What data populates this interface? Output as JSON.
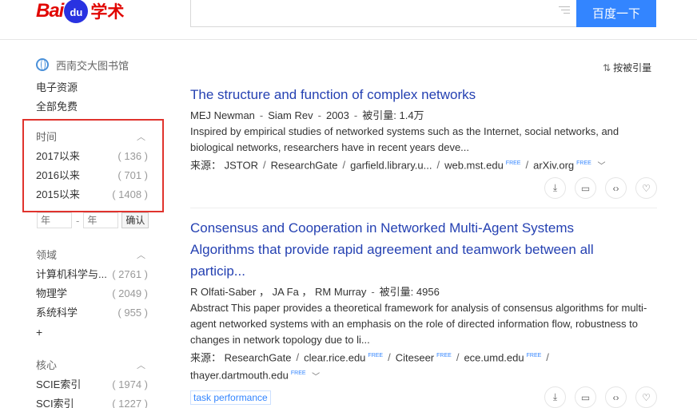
{
  "header": {
    "logo_bai": "Bai",
    "logo_du": "du",
    "logo_xueshu": "学术",
    "search_value": "",
    "search_button": "百度一下"
  },
  "sidebar": {
    "library": "西南交大图书馆",
    "links": [
      "电子资源",
      "全部免费"
    ],
    "time": {
      "title": "时间",
      "rows": [
        {
          "label": "2017以来",
          "count": "( 136 )"
        },
        {
          "label": "2016以来",
          "count": "( 701 )"
        },
        {
          "label": "2015以来",
          "count": "( 1408 )"
        }
      ],
      "year_from_placeholder": "年",
      "year_to_placeholder": "年",
      "confirm": "确认"
    },
    "field": {
      "title": "领域",
      "rows": [
        {
          "label": "计算机科学与...",
          "count": "( 2761 )"
        },
        {
          "label": "物理学",
          "count": "( 2049 )"
        },
        {
          "label": "系统科学",
          "count": "( 955 )"
        }
      ],
      "more": "+"
    },
    "core": {
      "title": "核心",
      "rows": [
        {
          "label": "SCIE索引",
          "count": "( 1974 )"
        },
        {
          "label": "SCI索引",
          "count": "( 1227 )"
        }
      ]
    }
  },
  "sort_label": "按被引量",
  "results": [
    {
      "title": "The structure and function of complex networks",
      "authors": "MEJ Newman",
      "journal": "Siam Rev",
      "year": "2003",
      "cited_label": "被引量:",
      "cited": "1.4万",
      "abstract_1": "Inspired by empirical studies of networked systems such as the Internet, social networks, and",
      "abstract_2": "biological networks, researchers have in recent years deve...",
      "source_label": "来源：",
      "sources": [
        "JSTOR",
        "ResearchGate",
        "garfield.library.u...",
        "web.mst.edu",
        "arXiv.org"
      ],
      "free_label": "FREE"
    },
    {
      "title_1": "Consensus and Cooperation in Networked Multi-Agent Systems",
      "title_2": "Algorithms that provide rapid agreement and teamwork between all",
      "title_3": "particip...",
      "authors": "R Olfati-Saber ， JA Fa ， RM Murray",
      "cited_label": "被引量:",
      "cited": "4956",
      "abstract_1": "Abstract This paper provides a theoretical framework for analysis of consensus algorithms for multi-",
      "abstract_2": "agent networked systems with an emphasis on the role of directed information flow, robustness to",
      "abstract_3": "changes in network topology due to li...",
      "source_label": "来源：",
      "sources": [
        "ResearchGate",
        "clear.rice.edu",
        "Citeseer",
        "ece.umd.edu",
        "thayer.dartmouth.edu"
      ],
      "free_label": "FREE",
      "tag": "task performance"
    }
  ]
}
